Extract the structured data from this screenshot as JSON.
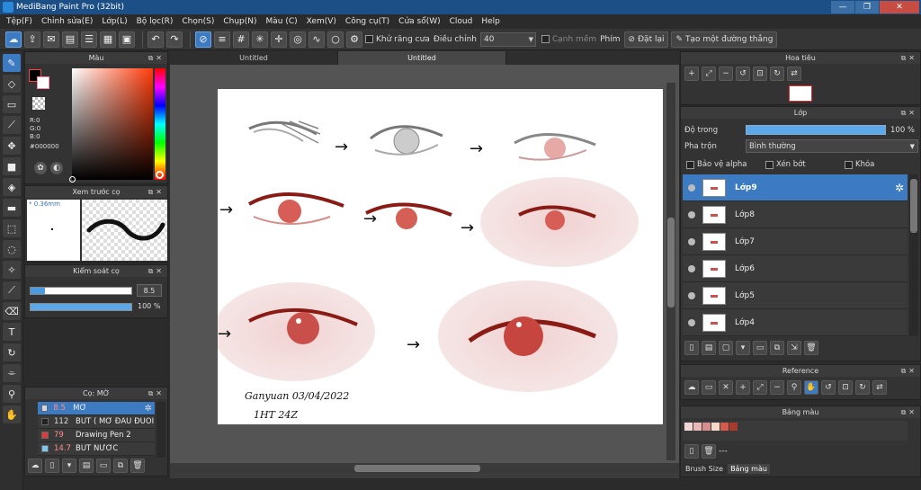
{
  "window": {
    "title": "MediBang Paint Pro (32bit)",
    "controls": [
      "—",
      "❐",
      "✕"
    ]
  },
  "menu": [
    "Tệp(F)",
    "Chỉnh sửa(E)",
    "Lớp(L)",
    "Bộ lọc(R)",
    "Chọn(S)",
    "Chụp(N)",
    "Màu (C)",
    "Xem(V)",
    "Công cụ(T)",
    "Cửa sổ(W)",
    "Cloud",
    "Help"
  ],
  "toolbar": {
    "antialias_label": "Khử răng cưa",
    "correction_label": "Điều chỉnh",
    "correction_value": "40",
    "canvas_edge_label": "Cạnh mềm",
    "key_label": "Phím",
    "reset_label": "Đặt lại",
    "straight_line_label": "Tạo một đường thẳng"
  },
  "color_panel": {
    "title": "Màu",
    "r": "R:0",
    "g": "G:0",
    "b": "B:0",
    "hex": "#000000"
  },
  "brush_preview": {
    "title": "Xem trước cọ",
    "size": "* 0.36mm"
  },
  "brush_control": {
    "title": "Kiểm soát cọ",
    "size_value": "8.5",
    "opacity_value": "100 %"
  },
  "brush_list": {
    "title": "Cọ: MỜ",
    "items": [
      {
        "size": "8.5",
        "name": "MỜ",
        "color": "#cfd8e6"
      },
      {
        "size": "112",
        "name": "BÚT ( MỞ ĐẦU ĐUÔI",
        "color": "#222222"
      },
      {
        "size": "79",
        "name": "Drawing Pen 2",
        "color": "#e53935"
      },
      {
        "size": "14.7",
        "name": "BÚT NƯỚC",
        "color": "#7ec8f0"
      }
    ]
  },
  "tabs": [
    "Untitled",
    "Untitled"
  ],
  "navigator": {
    "title": "Hoa tiêu"
  },
  "layer_panel": {
    "title": "Lớp",
    "opacity_label": "Độ trong",
    "opacity_value": "100 %",
    "blend_label": "Pha trộn",
    "blend_value": "Bình thường",
    "protect_alpha": "Bảo vệ alpha",
    "clipping": "Xén bớt",
    "lock": "Khóa",
    "layers": [
      "Lớp9",
      "Lớp8",
      "Lớp7",
      "Lớp6",
      "Lớp5",
      "Lớp4"
    ]
  },
  "reference_panel": {
    "title": "Reference"
  },
  "palette_panel": {
    "title": "Bảng màu",
    "swatches": [
      "#f2d7d7",
      "#e8b8b8",
      "#d88e8e",
      "#f5d9c8",
      "#d45b4b",
      "#a83a2e"
    ],
    "ellipsis": "---"
  },
  "bottom_tabs": [
    "Brush Size",
    "Bảng màu"
  ],
  "canvas_text": {
    "signature_line1": "Ganyuan 03/04/2022",
    "signature_line2": "1HT 24Z"
  }
}
